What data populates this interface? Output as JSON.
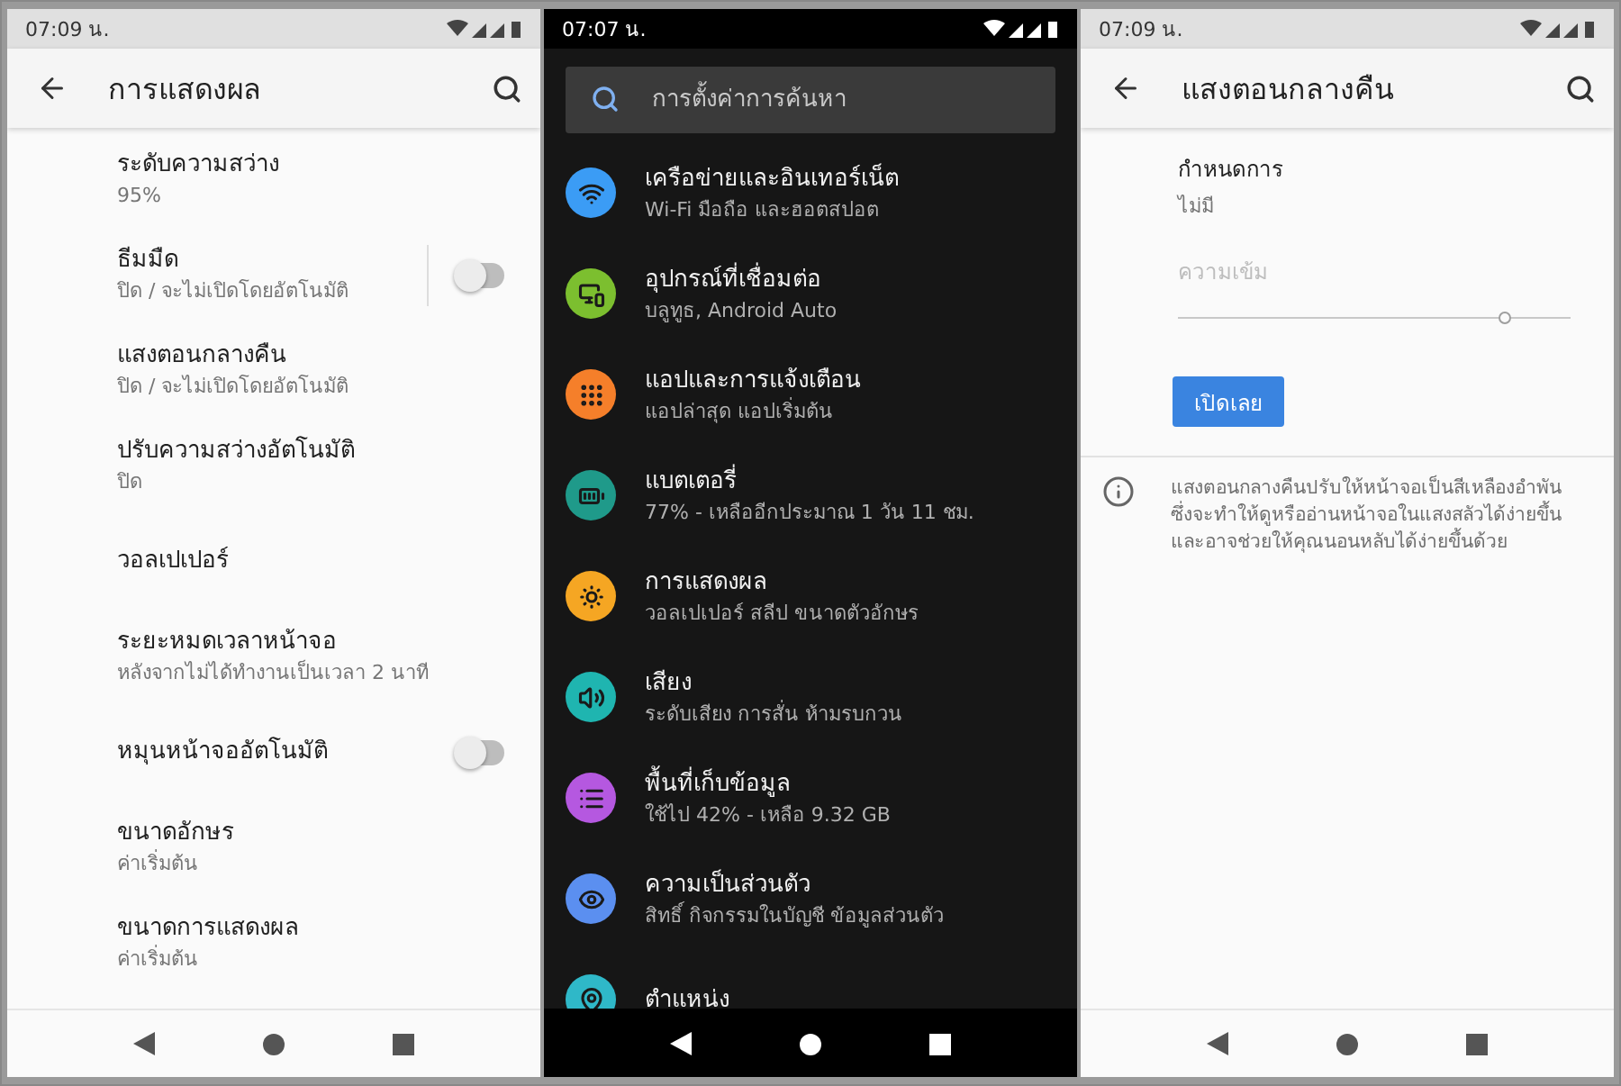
{
  "screens": [
    {
      "kind": "display",
      "status_time": "07:09 น.",
      "title": "การแสดงผล",
      "items": [
        {
          "kind": "text",
          "title": "ระดับความสว่าง",
          "subtitle": "95%"
        },
        {
          "kind": "split-toggle",
          "title": "ธีมมืด",
          "subtitle": "ปิด / จะไม่เปิดโดยอัตโนมัติ",
          "on": false
        },
        {
          "kind": "text",
          "title": "แสงตอนกลางคืน",
          "subtitle": "ปิด / จะไม่เปิดโดยอัตโนมัติ"
        },
        {
          "kind": "text",
          "title": "ปรับความสว่างอัตโนมัติ",
          "subtitle": "ปิด"
        },
        {
          "kind": "text",
          "title": "วอลเปเปอร์"
        },
        {
          "kind": "text",
          "title": "ระยะหมดเวลาหน้าจอ",
          "subtitle": "หลังจากไม่ได้ทำงานเป็นเวลา 2 นาที"
        },
        {
          "kind": "toggle",
          "title": "หมุนหน้าจออัตโนมัติ",
          "on": false
        },
        {
          "kind": "text",
          "title": "ขนาดอักษร",
          "subtitle": "ค่าเริ่มต้น"
        },
        {
          "kind": "text",
          "title": "ขนาดการแสดงผล",
          "subtitle": "ค่าเริ่มต้น"
        }
      ]
    },
    {
      "kind": "home",
      "status_time": "07:07 น.",
      "search": {
        "placeholder": "การตั้งค่าการค้นหา"
      },
      "items": [
        {
          "title": "เครือข่ายและอินเทอร์เน็ต",
          "subtitle": "Wi-Fi มือถือ และฮอตสปอต",
          "color": "#3b9cf5"
        },
        {
          "title": "อุปกรณ์ที่เชื่อมต่อ",
          "subtitle": "บลูทูธ, Android Auto",
          "color": "#7cbf2f"
        },
        {
          "title": "แอปและการแจ้งเตือน",
          "subtitle": "แอปล่าสุด แอปเริ่มต้น",
          "color": "#f57f2a"
        },
        {
          "title": "แบตเตอรี่",
          "subtitle": "77% - เหลืออีกประมาณ 1 วัน 11 ชม.",
          "color": "#1f9a8a"
        },
        {
          "title": "การแสดงผล",
          "subtitle": "วอลเปเปอร์ สลีป ขนาดตัวอักษร",
          "color": "#f5a623"
        },
        {
          "title": "เสียง",
          "subtitle": "ระดับเสียง การสั่น ห้ามรบกวน",
          "color": "#1fb5b0"
        },
        {
          "title": "พื้นที่เก็บข้อมูล",
          "subtitle": "ใช้ไป 42% - เหลือ 9.32 GB",
          "color": "#b558e0"
        },
        {
          "title": "ความเป็นส่วนตัว",
          "subtitle": "สิทธิ์ กิจกรรมในบัญชี ข้อมูลส่วนตัว",
          "color": "#5b8ff0"
        },
        {
          "title": "ตำแหน่ง",
          "color": "#2fb8c8"
        }
      ]
    },
    {
      "kind": "night-light",
      "status_time": "07:09 น.",
      "title": "แสงตอนกลางคืน",
      "schedule": {
        "label": "กำหนดการ",
        "value": "ไม่มี"
      },
      "intensity": {
        "label": "ความเข้ม",
        "disabled": true,
        "level": 0.83
      },
      "button": "เปิดเลย",
      "info": "แสงตอนกลางคืนปรับให้หน้าจอเป็นสีเหลืองอำพัน ซึ่งจะทำให้ดูหรืออ่านหน้าจอในแสงสลัวได้ง่ายขึ้น และอาจช่วยให้คุณนอนหลับได้ง่ายขึ้นด้วย"
    }
  ]
}
